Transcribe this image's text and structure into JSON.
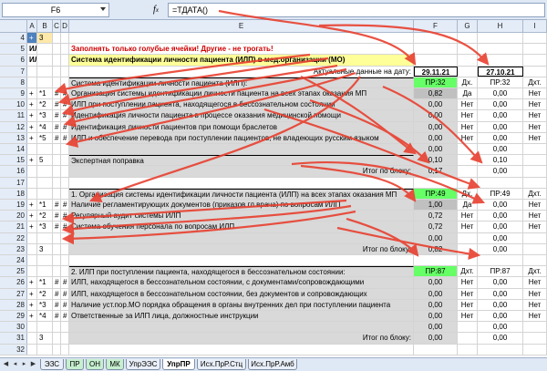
{
  "formula_bar": {
    "name_box": "F6",
    "fx_icon": "fx-icon",
    "formula": "=ТДАТА()"
  },
  "columns": [
    "A",
    "B",
    "C",
    "D",
    "E",
    "F",
    "G",
    "H",
    "I"
  ],
  "rows": [
    {
      "n": "4",
      "a": "+",
      "b": "3",
      "e": "",
      "f": "",
      "g": "",
      "h": "",
      "i": ""
    },
    {
      "n": "5",
      "a": "ИЛ",
      "b": "",
      "e": "Заполнять только голубые ячейки! Другие - не трогать!",
      "f": "",
      "g": "",
      "h": "",
      "i": ""
    },
    {
      "n": "6",
      "a": "ИЛ",
      "b": "",
      "e": "Система идентификации личности пациента (ИЛП) в мед.организации (МО)",
      "f": "",
      "g": "",
      "h": "",
      "i": ""
    },
    {
      "n": "7",
      "a": "",
      "b": "",
      "e": "Актуальные данные на дату:",
      "f": "29.11.21",
      "g": "",
      "h": "27.10.21",
      "i": ""
    },
    {
      "n": "8",
      "a": "",
      "b": "",
      "e": "Система идентификации личности пациента (ИЛП):",
      "f": "ПР:32",
      "g": "Дх.",
      "h": "ПР:32",
      "i": "Дхт."
    },
    {
      "n": "9",
      "a": "+",
      "b": "*1",
      "e": "Организация системы идентификации личности пациента на всех этапах оказания МП",
      "f": "0,82",
      "g": "Да",
      "h": "0,00",
      "i": "Нет"
    },
    {
      "n": "10",
      "a": "+",
      "b": "*2",
      "e": "ИЛП при поступлении пациента, находящегося в бессознательном состоянии",
      "f": "0,00",
      "g": "Нет",
      "h": "0,00",
      "i": "Нет"
    },
    {
      "n": "11",
      "a": "+",
      "b": "*3",
      "e": "Идентификация личности пациента в процессе оказания медицинской помощи",
      "f": "0,00",
      "g": "Нет",
      "h": "0,00",
      "i": "Нет"
    },
    {
      "n": "12",
      "a": "+",
      "b": "*4",
      "e": "Идентификация личности пациентов при помощи браслетов",
      "f": "0,00",
      "g": "Нет",
      "h": "0,00",
      "i": "Нет"
    },
    {
      "n": "13",
      "a": "+",
      "b": "*5",
      "e": "ИЛП и обеспечение перевода при поступлении пациентов, не владеющих русским языком",
      "f": "0,00",
      "g": "Нет",
      "h": "0,00",
      "i": "Нет"
    },
    {
      "n": "14",
      "a": "",
      "b": "",
      "e": "",
      "f": "0,00",
      "g": "",
      "h": "0,00",
      "i": ""
    },
    {
      "n": "15",
      "a": "+",
      "b": "5",
      "e": "Экспертная поправка",
      "f": "0,10",
      "g": "",
      "h": "0,10",
      "i": ""
    },
    {
      "n": "16",
      "a": "",
      "b": "",
      "e": "Итог по блоку:",
      "f": "0,17",
      "g": "",
      "h": "0,00",
      "i": ""
    },
    {
      "n": "17",
      "a": "",
      "b": "",
      "e": "",
      "f": "",
      "g": "",
      "h": "",
      "i": ""
    },
    {
      "n": "18",
      "a": "",
      "b": "",
      "e": "1. Организация системы идентификации личности пациента (ИЛП) на всех этапах оказания МП",
      "f": "ПР:49",
      "g": "Дх.",
      "h": "ПР:49",
      "i": "Дхт."
    },
    {
      "n": "19",
      "a": "+",
      "b": "*1",
      "e": "Наличие регламентирующих документов (приказов гл.врача) по вопросам ИЛП",
      "f": "1,00",
      "g": "Да",
      "h": "0,00",
      "i": "Нет"
    },
    {
      "n": "20",
      "a": "+",
      "b": "*2",
      "e": "Регулярный аудит системы ИЛП",
      "f": "0,72",
      "g": "Нет",
      "h": "0,00",
      "i": "Нет"
    },
    {
      "n": "21",
      "a": "+",
      "b": "*3",
      "e": "Система обучения персонала по вопросам ИЛП",
      "f": "0,72",
      "g": "Нет",
      "h": "0,00",
      "i": "Нет"
    },
    {
      "n": "22",
      "a": "",
      "b": "",
      "e": "",
      "f": "0,00",
      "g": "",
      "h": "0,00",
      "i": ""
    },
    {
      "n": "23",
      "a": "",
      "b": "3",
      "e": "Итог по блоку:",
      "f": "0,82",
      "g": "",
      "h": "0,00",
      "i": ""
    },
    {
      "n": "24",
      "a": "",
      "b": "",
      "e": "",
      "f": "",
      "g": "",
      "h": "",
      "i": ""
    },
    {
      "n": "25",
      "a": "",
      "b": "",
      "e": "2. ИЛП при поступлении пациента, находящегося в бессознательном состоянии:",
      "f": "ПР:87",
      "g": "Дхт.",
      "h": "ПР:87",
      "i": "Дхт."
    },
    {
      "n": "26",
      "a": "+",
      "b": "*1",
      "e": "ИЛП, находящегося в бессознательном состоянии, с документами/сопровождающими",
      "f": "0,00",
      "g": "Нет",
      "h": "0,00",
      "i": "Нет"
    },
    {
      "n": "27",
      "a": "+",
      "b": "*2",
      "e": "ИЛП, находящегося в бессознательном состоянии, без документов и сопровождающих",
      "f": "0,00",
      "g": "Нет",
      "h": "0,00",
      "i": "Нет"
    },
    {
      "n": "28",
      "a": "+",
      "b": "*3",
      "e": "Наличие уст.пор.МО порядка обращения в органы внутренних дел при поступлении пациента",
      "f": "0,00",
      "g": "Нет",
      "h": "0,00",
      "i": "Нет"
    },
    {
      "n": "29",
      "a": "+",
      "b": "*4",
      "e": "Ответственные за ИЛП лица, должностные инструкции",
      "f": "0,00",
      "g": "Нет",
      "h": "0,00",
      "i": "Нет"
    },
    {
      "n": "30",
      "a": "",
      "b": "",
      "e": "",
      "f": "0,00",
      "g": "",
      "h": "0,00",
      "i": ""
    },
    {
      "n": "31",
      "a": "",
      "b": "3",
      "e": "Итог по блоку:",
      "f": "0,00",
      "g": "",
      "h": "0,00",
      "i": ""
    },
    {
      "n": "32",
      "a": "",
      "b": "",
      "e": "",
      "f": "",
      "g": "",
      "h": "",
      "i": ""
    }
  ],
  "sheet_tabs": [
    "ЭЗС",
    "ПР",
    "ОН",
    "МК",
    "УпрЭЭС",
    "УпрПР",
    "Исх.ПрР.Стц",
    "Исх.ПрР.Амб"
  ],
  "active_tab": "УпрПР",
  "colors": {
    "header": "#e4ecf7",
    "yellow": "#ffff99",
    "green": "#66ff66",
    "gray": "#d9d9d9",
    "red": "#e8402f"
  }
}
